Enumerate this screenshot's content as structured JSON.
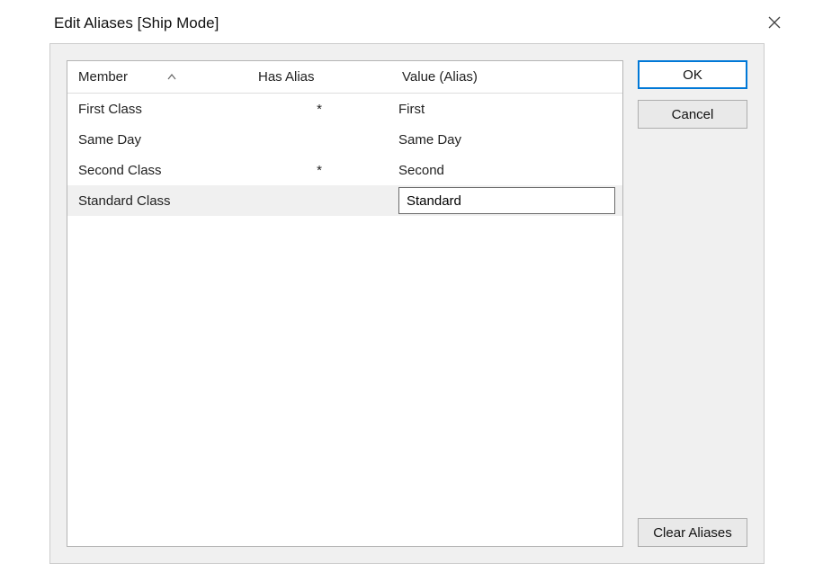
{
  "dialog": {
    "title": "Edit Aliases [Ship Mode]"
  },
  "columns": {
    "member": "Member",
    "hasAlias": "Has Alias",
    "value": "Value (Alias)"
  },
  "rows": [
    {
      "member": "First Class",
      "hasAlias": "*",
      "value": "First",
      "editing": false,
      "selected": false
    },
    {
      "member": "Same Day",
      "hasAlias": "",
      "value": "Same Day",
      "editing": false,
      "selected": false
    },
    {
      "member": "Second Class",
      "hasAlias": "*",
      "value": "Second",
      "editing": false,
      "selected": false
    },
    {
      "member": "Standard Class",
      "hasAlias": "",
      "value": "Standard",
      "editing": true,
      "selected": true
    }
  ],
  "buttons": {
    "ok": "OK",
    "cancel": "Cancel",
    "clear": "Clear Aliases"
  }
}
